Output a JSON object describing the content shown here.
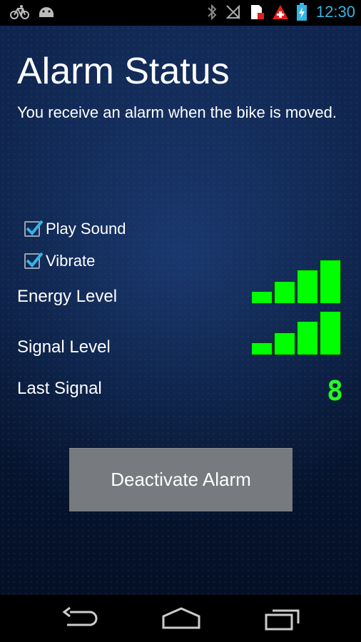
{
  "status_bar": {
    "time": "12:30",
    "icons_left": [
      "bike-icon",
      "android-icon"
    ],
    "icons_right": [
      "bluetooth-icon",
      "signal-off-icon",
      "sim-alert-icon",
      "swiss-app-icon",
      "battery-charging-icon"
    ]
  },
  "header": {
    "title": "Alarm Status",
    "description": "You receive an alarm when the bike is moved."
  },
  "options": {
    "play_sound": {
      "label": "Play Sound",
      "checked": true
    },
    "vibrate": {
      "label": "Vibrate",
      "checked": true
    }
  },
  "levels": {
    "energy_label": "Energy Level",
    "energy_bars_filled": 4,
    "energy_bars_total": 4,
    "signal_label": "Signal Level",
    "signal_bars_filled": 4,
    "signal_bars_total": 4
  },
  "last_signal": {
    "label": "Last Signal",
    "value": "8"
  },
  "actions": {
    "deactivate_label": "Deactivate Alarm"
  },
  "colors": {
    "accent": "#33b5e5",
    "level_green": "#00ff00",
    "button_gray": "#777a7e"
  }
}
